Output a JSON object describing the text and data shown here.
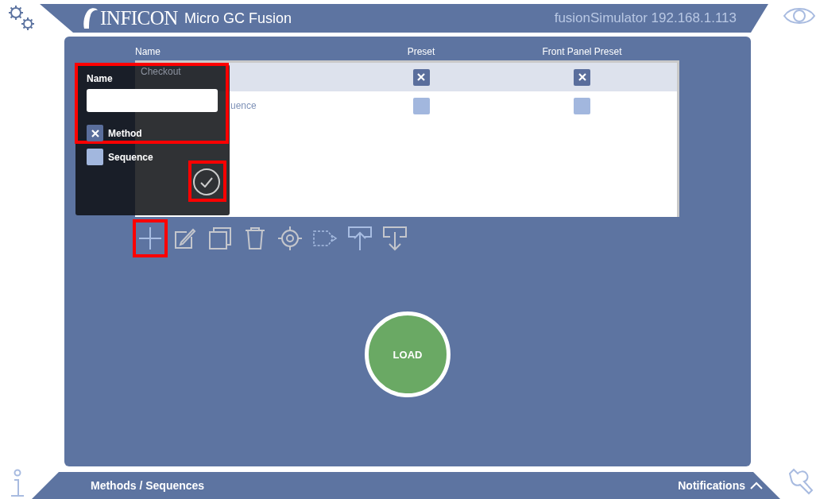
{
  "header": {
    "brand": "INFICON",
    "title": "Micro GC Fusion",
    "device": "fusionSimulator 192.168.1.113"
  },
  "table": {
    "columns": [
      "Name",
      "Preset",
      "Front Panel Preset"
    ],
    "rows": [
      {
        "name": "Checkout",
        "preset": true,
        "front_panel_preset": true,
        "selected": true
      },
      {
        "name": "uence",
        "preset": false,
        "front_panel_preset": false,
        "selected": false
      }
    ]
  },
  "dialog": {
    "name_label": "Name",
    "form_highlighted": true,
    "confirm_highlighted": true,
    "options": [
      {
        "label": "Method",
        "checked": true
      },
      {
        "label": "Sequence",
        "checked": false
      }
    ]
  },
  "toolbar": [
    {
      "kind": "add",
      "disabled": false,
      "highlighted": true
    },
    {
      "kind": "edit",
      "disabled": true,
      "highlighted": false
    },
    {
      "kind": "copy",
      "disabled": true,
      "highlighted": false
    },
    {
      "kind": "delete",
      "disabled": true,
      "highlighted": false
    },
    {
      "kind": "target",
      "disabled": true,
      "highlighted": false
    },
    {
      "kind": "export",
      "disabled": false,
      "highlighted": false
    },
    {
      "kind": "upload",
      "disabled": false,
      "highlighted": false
    },
    {
      "kind": "download",
      "disabled": true,
      "highlighted": false
    }
  ],
  "load_button": "LOAD",
  "footer": {
    "section": "Methods / Sequences",
    "notifications": "Notifications"
  }
}
